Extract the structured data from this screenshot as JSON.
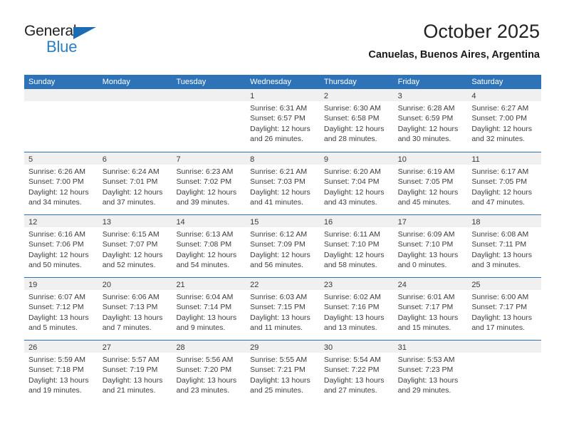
{
  "brand": {
    "name_part1": "General",
    "name_part2": "Blue",
    "triangle_icon": "triangle-icon",
    "color_dark": "#231f20",
    "color_blue": "#2b7ec1"
  },
  "header": {
    "title": "October 2025",
    "subtitle": "Canuelas, Buenos Aires, Argentina"
  },
  "theme": {
    "header_blue": "#2e73b8",
    "date_band_gray": "#f0f0f0",
    "text_color": "#3c3c3c"
  },
  "calendar": {
    "weekday_headers": [
      "Sunday",
      "Monday",
      "Tuesday",
      "Wednesday",
      "Thursday",
      "Friday",
      "Saturday"
    ],
    "weeks": [
      [
        {
          "day": "",
          "sunrise": "",
          "sunset": "",
          "daylight": "",
          "empty": true
        },
        {
          "day": "",
          "sunrise": "",
          "sunset": "",
          "daylight": "",
          "empty": true
        },
        {
          "day": "",
          "sunrise": "",
          "sunset": "",
          "daylight": "",
          "empty": true
        },
        {
          "day": "1",
          "sunrise": "Sunrise: 6:31 AM",
          "sunset": "Sunset: 6:57 PM",
          "daylight_l1": "Daylight: 12 hours",
          "daylight_l2": "and 26 minutes."
        },
        {
          "day": "2",
          "sunrise": "Sunrise: 6:30 AM",
          "sunset": "Sunset: 6:58 PM",
          "daylight_l1": "Daylight: 12 hours",
          "daylight_l2": "and 28 minutes."
        },
        {
          "day": "3",
          "sunrise": "Sunrise: 6:28 AM",
          "sunset": "Sunset: 6:59 PM",
          "daylight_l1": "Daylight: 12 hours",
          "daylight_l2": "and 30 minutes."
        },
        {
          "day": "4",
          "sunrise": "Sunrise: 6:27 AM",
          "sunset": "Sunset: 7:00 PM",
          "daylight_l1": "Daylight: 12 hours",
          "daylight_l2": "and 32 minutes."
        }
      ],
      [
        {
          "day": "5",
          "sunrise": "Sunrise: 6:26 AM",
          "sunset": "Sunset: 7:00 PM",
          "daylight_l1": "Daylight: 12 hours",
          "daylight_l2": "and 34 minutes."
        },
        {
          "day": "6",
          "sunrise": "Sunrise: 6:24 AM",
          "sunset": "Sunset: 7:01 PM",
          "daylight_l1": "Daylight: 12 hours",
          "daylight_l2": "and 37 minutes."
        },
        {
          "day": "7",
          "sunrise": "Sunrise: 6:23 AM",
          "sunset": "Sunset: 7:02 PM",
          "daylight_l1": "Daylight: 12 hours",
          "daylight_l2": "and 39 minutes."
        },
        {
          "day": "8",
          "sunrise": "Sunrise: 6:21 AM",
          "sunset": "Sunset: 7:03 PM",
          "daylight_l1": "Daylight: 12 hours",
          "daylight_l2": "and 41 minutes."
        },
        {
          "day": "9",
          "sunrise": "Sunrise: 6:20 AM",
          "sunset": "Sunset: 7:04 PM",
          "daylight_l1": "Daylight: 12 hours",
          "daylight_l2": "and 43 minutes."
        },
        {
          "day": "10",
          "sunrise": "Sunrise: 6:19 AM",
          "sunset": "Sunset: 7:05 PM",
          "daylight_l1": "Daylight: 12 hours",
          "daylight_l2": "and 45 minutes."
        },
        {
          "day": "11",
          "sunrise": "Sunrise: 6:17 AM",
          "sunset": "Sunset: 7:05 PM",
          "daylight_l1": "Daylight: 12 hours",
          "daylight_l2": "and 47 minutes."
        }
      ],
      [
        {
          "day": "12",
          "sunrise": "Sunrise: 6:16 AM",
          "sunset": "Sunset: 7:06 PM",
          "daylight_l1": "Daylight: 12 hours",
          "daylight_l2": "and 50 minutes."
        },
        {
          "day": "13",
          "sunrise": "Sunrise: 6:15 AM",
          "sunset": "Sunset: 7:07 PM",
          "daylight_l1": "Daylight: 12 hours",
          "daylight_l2": "and 52 minutes."
        },
        {
          "day": "14",
          "sunrise": "Sunrise: 6:13 AM",
          "sunset": "Sunset: 7:08 PM",
          "daylight_l1": "Daylight: 12 hours",
          "daylight_l2": "and 54 minutes."
        },
        {
          "day": "15",
          "sunrise": "Sunrise: 6:12 AM",
          "sunset": "Sunset: 7:09 PM",
          "daylight_l1": "Daylight: 12 hours",
          "daylight_l2": "and 56 minutes."
        },
        {
          "day": "16",
          "sunrise": "Sunrise: 6:11 AM",
          "sunset": "Sunset: 7:10 PM",
          "daylight_l1": "Daylight: 12 hours",
          "daylight_l2": "and 58 minutes."
        },
        {
          "day": "17",
          "sunrise": "Sunrise: 6:09 AM",
          "sunset": "Sunset: 7:10 PM",
          "daylight_l1": "Daylight: 13 hours",
          "daylight_l2": "and 0 minutes."
        },
        {
          "day": "18",
          "sunrise": "Sunrise: 6:08 AM",
          "sunset": "Sunset: 7:11 PM",
          "daylight_l1": "Daylight: 13 hours",
          "daylight_l2": "and 3 minutes."
        }
      ],
      [
        {
          "day": "19",
          "sunrise": "Sunrise: 6:07 AM",
          "sunset": "Sunset: 7:12 PM",
          "daylight_l1": "Daylight: 13 hours",
          "daylight_l2": "and 5 minutes."
        },
        {
          "day": "20",
          "sunrise": "Sunrise: 6:06 AM",
          "sunset": "Sunset: 7:13 PM",
          "daylight_l1": "Daylight: 13 hours",
          "daylight_l2": "and 7 minutes."
        },
        {
          "day": "21",
          "sunrise": "Sunrise: 6:04 AM",
          "sunset": "Sunset: 7:14 PM",
          "daylight_l1": "Daylight: 13 hours",
          "daylight_l2": "and 9 minutes."
        },
        {
          "day": "22",
          "sunrise": "Sunrise: 6:03 AM",
          "sunset": "Sunset: 7:15 PM",
          "daylight_l1": "Daylight: 13 hours",
          "daylight_l2": "and 11 minutes."
        },
        {
          "day": "23",
          "sunrise": "Sunrise: 6:02 AM",
          "sunset": "Sunset: 7:16 PM",
          "daylight_l1": "Daylight: 13 hours",
          "daylight_l2": "and 13 minutes."
        },
        {
          "day": "24",
          "sunrise": "Sunrise: 6:01 AM",
          "sunset": "Sunset: 7:17 PM",
          "daylight_l1": "Daylight: 13 hours",
          "daylight_l2": "and 15 minutes."
        },
        {
          "day": "25",
          "sunrise": "Sunrise: 6:00 AM",
          "sunset": "Sunset: 7:17 PM",
          "daylight_l1": "Daylight: 13 hours",
          "daylight_l2": "and 17 minutes."
        }
      ],
      [
        {
          "day": "26",
          "sunrise": "Sunrise: 5:59 AM",
          "sunset": "Sunset: 7:18 PM",
          "daylight_l1": "Daylight: 13 hours",
          "daylight_l2": "and 19 minutes."
        },
        {
          "day": "27",
          "sunrise": "Sunrise: 5:57 AM",
          "sunset": "Sunset: 7:19 PM",
          "daylight_l1": "Daylight: 13 hours",
          "daylight_l2": "and 21 minutes."
        },
        {
          "day": "28",
          "sunrise": "Sunrise: 5:56 AM",
          "sunset": "Sunset: 7:20 PM",
          "daylight_l1": "Daylight: 13 hours",
          "daylight_l2": "and 23 minutes."
        },
        {
          "day": "29",
          "sunrise": "Sunrise: 5:55 AM",
          "sunset": "Sunset: 7:21 PM",
          "daylight_l1": "Daylight: 13 hours",
          "daylight_l2": "and 25 minutes."
        },
        {
          "day": "30",
          "sunrise": "Sunrise: 5:54 AM",
          "sunset": "Sunset: 7:22 PM",
          "daylight_l1": "Daylight: 13 hours",
          "daylight_l2": "and 27 minutes."
        },
        {
          "day": "31",
          "sunrise": "Sunrise: 5:53 AM",
          "sunset": "Sunset: 7:23 PM",
          "daylight_l1": "Daylight: 13 hours",
          "daylight_l2": "and 29 minutes."
        },
        {
          "day": "",
          "sunrise": "",
          "sunset": "",
          "daylight": "",
          "empty": true
        }
      ]
    ]
  }
}
